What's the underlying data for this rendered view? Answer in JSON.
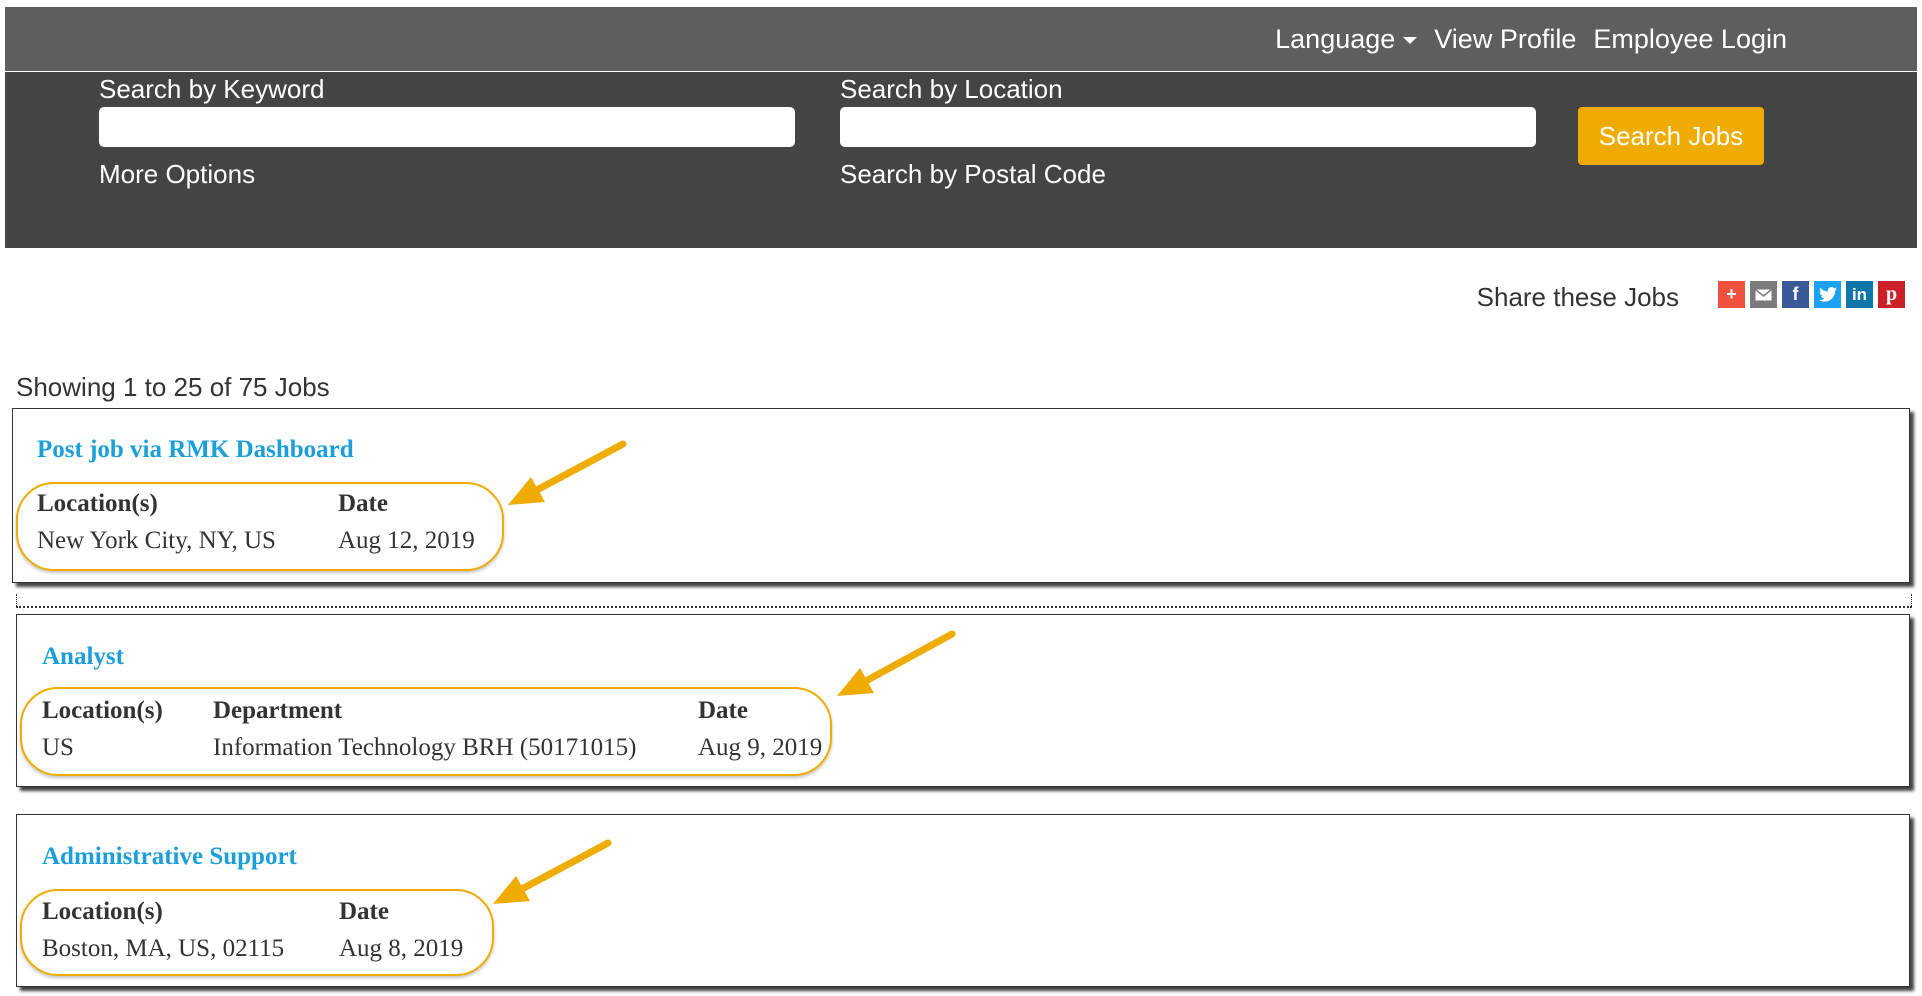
{
  "topnav": {
    "language": "Language",
    "view_profile": "View Profile",
    "employee_login": "Employee Login"
  },
  "search": {
    "keyword_label": "Search by Keyword",
    "keyword_value": "",
    "location_label": "Search by Location",
    "location_value": "",
    "more_options": "More Options",
    "postal_code": "Search by Postal Code",
    "button": "Search Jobs"
  },
  "share": {
    "label": "Share these Jobs",
    "icons": [
      "share-plus-icon",
      "email-icon",
      "facebook-icon",
      "twitter-icon",
      "linkedin-icon",
      "pinterest-icon"
    ],
    "colors": {
      "plus": "#f0523f",
      "email": "#7b7b7b",
      "facebook": "#3b5998",
      "twitter": "#1da1f2",
      "linkedin": "#0e76a8",
      "pinterest": "#cb2027"
    }
  },
  "results": {
    "summary": "Showing 1 to 25 of 75 Jobs"
  },
  "jobs": [
    {
      "title": "Post job via RMK Dashboard",
      "location_header": "Location(s)",
      "location": "New York City, NY, US",
      "date_header": "Date",
      "date": "Aug 12, 2019"
    },
    {
      "title": "Analyst",
      "location_header": "Location(s)",
      "location": "US",
      "department_header": "Department",
      "department": "Information Technology BRH (50171015)",
      "date_header": "Date",
      "date": "Aug 9, 2019"
    },
    {
      "title": "Administrative Support",
      "location_header": "Location(s)",
      "location": "Boston, MA, US, 02115",
      "date_header": "Date",
      "date": "Aug 8, 2019"
    }
  ],
  "colors": {
    "accent": "#f0ab00",
    "link": "#1a9fd9",
    "topbar": "#5e5e5e",
    "searchbar": "#444444"
  }
}
